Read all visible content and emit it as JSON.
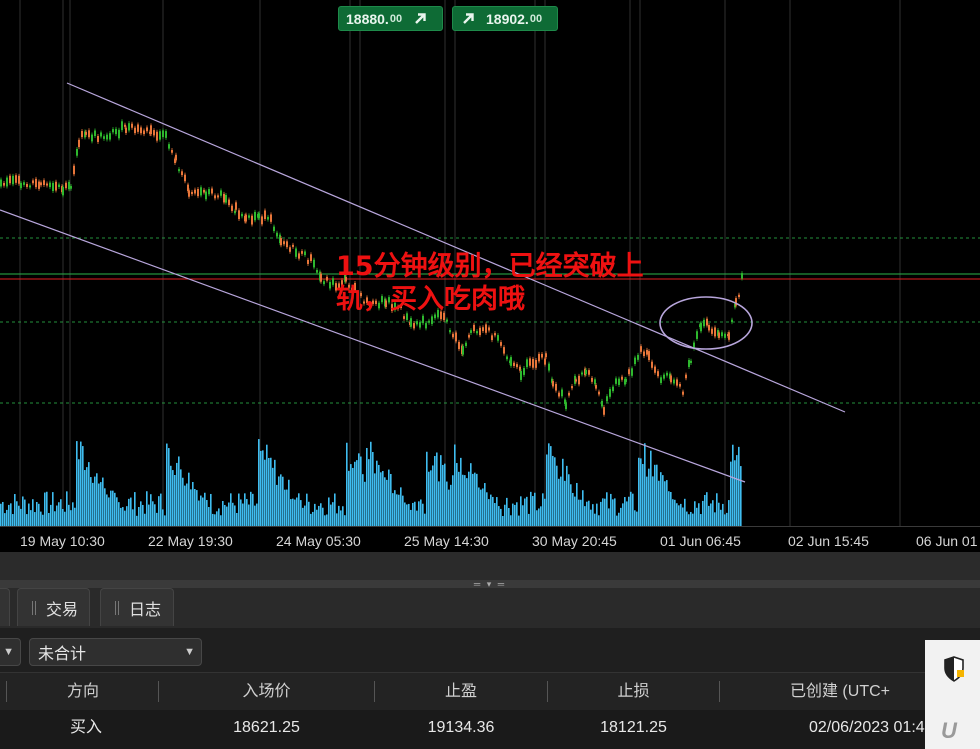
{
  "price_badges": {
    "ask": {
      "main": "18880.",
      "decimals": "00",
      "direction": "up-right-arrow"
    },
    "bid": {
      "main": "18902.",
      "decimals": "00",
      "direction": "up-right-arrow"
    }
  },
  "annotation": {
    "line1": "15分钟级别，已经突破上",
    "line2": "轨，买入吃肉哦",
    "color": "#ee1111"
  },
  "time_axis": {
    "labels": [
      "19 May 10:30",
      "22 May 19:30",
      "24 May 05:30",
      "25 May 14:30",
      "30 May 20:45",
      "01 Jun 06:45",
      "02 Jun 15:45",
      "06 Jun 01"
    ]
  },
  "chart_colors": {
    "background": "#000000",
    "up_candle": "#2eb82e",
    "down_candle": "#e8763a",
    "volume": "#3fbdf0",
    "channel": "#b8a6dc",
    "resistance": "#e02020",
    "support": "#2db34a",
    "highlight_ellipse": "#b8a6dc"
  },
  "tabs": {
    "trade": "交易",
    "log": "日志"
  },
  "filter": {
    "total_label": "未合计"
  },
  "table": {
    "headers": [
      "方向",
      "入场价",
      "止盈",
      "止损",
      "已创建 (UTC+"
    ],
    "rows": [
      {
        "direction": "买入",
        "entry": "18621.25",
        "take_profit": "19134.36",
        "stop_loss": "18121.25",
        "created": "02/06/2023 01:4"
      }
    ]
  },
  "widgets": {
    "shield_icon": "shield-icon",
    "logo": "U"
  }
}
